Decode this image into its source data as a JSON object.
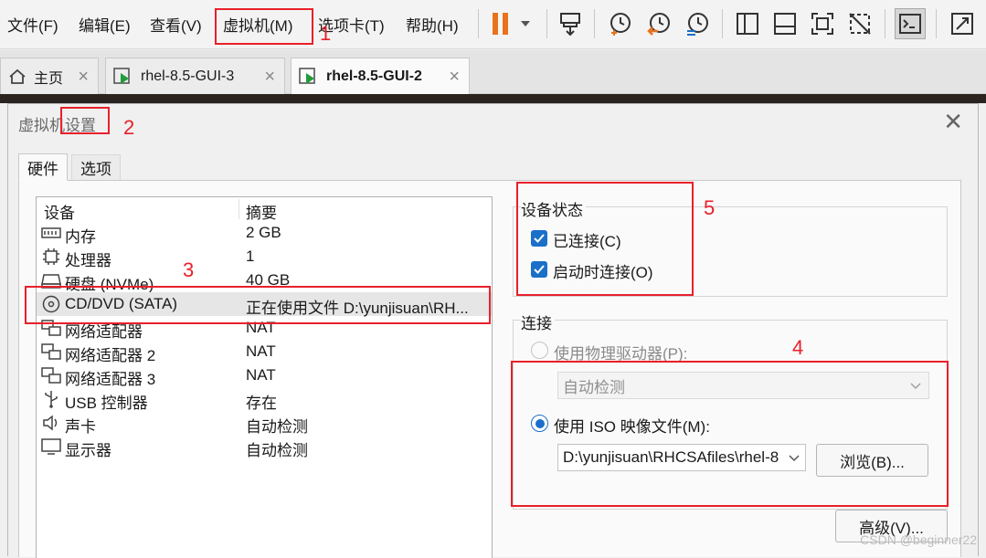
{
  "menu": {
    "file": "文件(F)",
    "edit": "编辑(E)",
    "view": "查看(V)",
    "vm": "虚拟机(M)",
    "tabs": "选项卡(T)",
    "help": "帮助(H)"
  },
  "toolbar_icons": [
    "pause-icon",
    "dropdown-arrow-icon",
    "send-keys-icon",
    "snapshot-take-icon",
    "snapshot-revert-icon",
    "snapshot-manager-icon",
    "sidebar-layout-icon",
    "thumbnail-layout-icon",
    "fullscreen-icon",
    "unity-icon",
    "console-view-icon",
    "stretch-icon"
  ],
  "tabs": [
    {
      "label": "主页"
    },
    {
      "label": "rhel-8.5-GUI-3"
    },
    {
      "label": "rhel-8.5-GUI-2"
    }
  ],
  "dialog": {
    "title": "虚拟机设置",
    "hardware_tab": "硬件",
    "options_tab": "选项"
  },
  "device_list": {
    "header_device": "设备",
    "header_summary": "摘要",
    "rows": [
      {
        "name": "内存",
        "summary": "2 GB",
        "icon": "memory-icon"
      },
      {
        "name": "处理器",
        "summary": "1",
        "icon": "cpu-icon"
      },
      {
        "name": "硬盘 (NVMe)",
        "summary": "40 GB",
        "icon": "harddisk-icon"
      },
      {
        "name": "CD/DVD (SATA)",
        "summary": "正在使用文件 D:\\yunjisuan\\RH...",
        "icon": "cd-dvd-icon"
      },
      {
        "name": "网络适配器",
        "summary": "NAT",
        "icon": "network-adapter-icon"
      },
      {
        "name": "网络适配器 2",
        "summary": "NAT",
        "icon": "network-adapter-icon"
      },
      {
        "name": "网络适配器 3",
        "summary": "NAT",
        "icon": "network-adapter-icon"
      },
      {
        "name": "USB 控制器",
        "summary": "存在",
        "icon": "usb-icon"
      },
      {
        "name": "声卡",
        "summary": "自动检测",
        "icon": "sound-icon"
      },
      {
        "name": "显示器",
        "summary": "自动检测",
        "icon": "display-icon"
      }
    ]
  },
  "device_status": {
    "title": "设备状态",
    "connected": "已连接(C)",
    "connect_at_power_on": "启动时连接(O)"
  },
  "connection": {
    "title": "连接",
    "physical_drive": "使用物理驱动器(P):",
    "auto_detect": "自动检测",
    "iso_image": "使用 ISO 映像文件(M):",
    "iso_path": "D:\\yunjisuan\\RHCSAfiles\\rhel-8",
    "browse": "浏览(B)..."
  },
  "advanced_button": "高级(V)...",
  "annotations": [
    "1",
    "2",
    "3",
    "4",
    "5"
  ],
  "watermark": "CSDN @beginner22",
  "colors": {
    "accent": "#1a6fc9",
    "annotation_red": "#e8202a",
    "pause_orange": "#e8721c"
  }
}
